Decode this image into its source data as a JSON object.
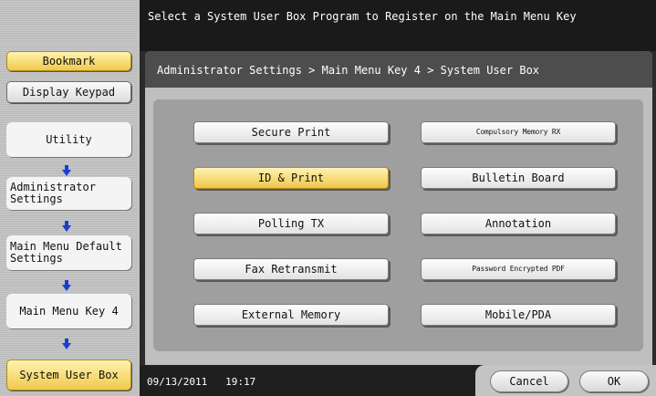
{
  "sidebar": {
    "bookmark": "Bookmark",
    "display_keypad": "Display Keypad",
    "steps": [
      "Utility",
      "Administrator Settings",
      "Main Menu Default Settings",
      "Main Menu Key 4",
      "System User Box"
    ]
  },
  "banner": {
    "instruction": "Select a System User Box Program to Register on the Main Menu Key"
  },
  "breadcrumb": "Administrator Settings > Main Menu Key 4 > System User Box",
  "options": {
    "left": [
      "Secure Print",
      "ID & Print",
      "Polling TX",
      "Fax Retransmit",
      "External Memory"
    ],
    "right": [
      "Compulsory Memory RX",
      "Bulletin Board",
      "Annotation",
      "Password Encrypted PDF",
      "Mobile/PDA"
    ],
    "selected": "ID & Print"
  },
  "footer": {
    "date": "09/13/2011",
    "time": "19:17",
    "cancel": "Cancel",
    "ok": "OK"
  },
  "colors": {
    "selected": "#f0c64a",
    "arrow": "#1a3fd0",
    "banner": "#1a1a1a"
  }
}
